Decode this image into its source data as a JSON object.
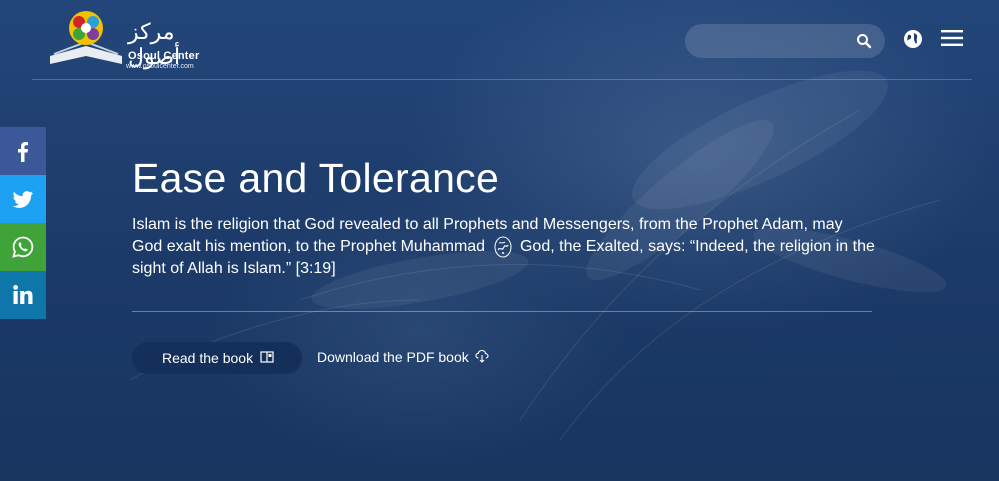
{
  "header": {
    "logo": {
      "name_ar": "مركز أصول",
      "name_en": "Osoul Center",
      "url": "www.osoulcenter.com"
    },
    "search": {
      "value": "",
      "placeholder": ""
    },
    "icons": [
      "search-icon",
      "globe-icon",
      "menu-icon"
    ]
  },
  "social": [
    {
      "name": "facebook",
      "icon": "facebook-icon",
      "color": "#3b5998"
    },
    {
      "name": "twitter",
      "icon": "twitter-icon",
      "color": "#1da1f2"
    },
    {
      "name": "whatsapp",
      "icon": "whatsapp-icon",
      "color": "#3fa33a"
    },
    {
      "name": "linkedin",
      "icon": "linkedin-icon",
      "color": "#0e76a8"
    }
  ],
  "main": {
    "title": "Ease and Tolerance",
    "description_part1": "Islam is the religion that God revealed to all Prophets and Messengers, from the Prophet Adam, may God exalt his mention, to the Prophet Muhammad",
    "description_part2": "God, the Exalted, says: “Indeed, the religion in the sight of Allah is Islam.” [3:19]",
    "read_button": "Read the book",
    "download_link": "Download the PDF book"
  },
  "colors": {
    "background": "#1d3c6b",
    "button_bg": "#142f5a",
    "text": "#ffffff"
  }
}
